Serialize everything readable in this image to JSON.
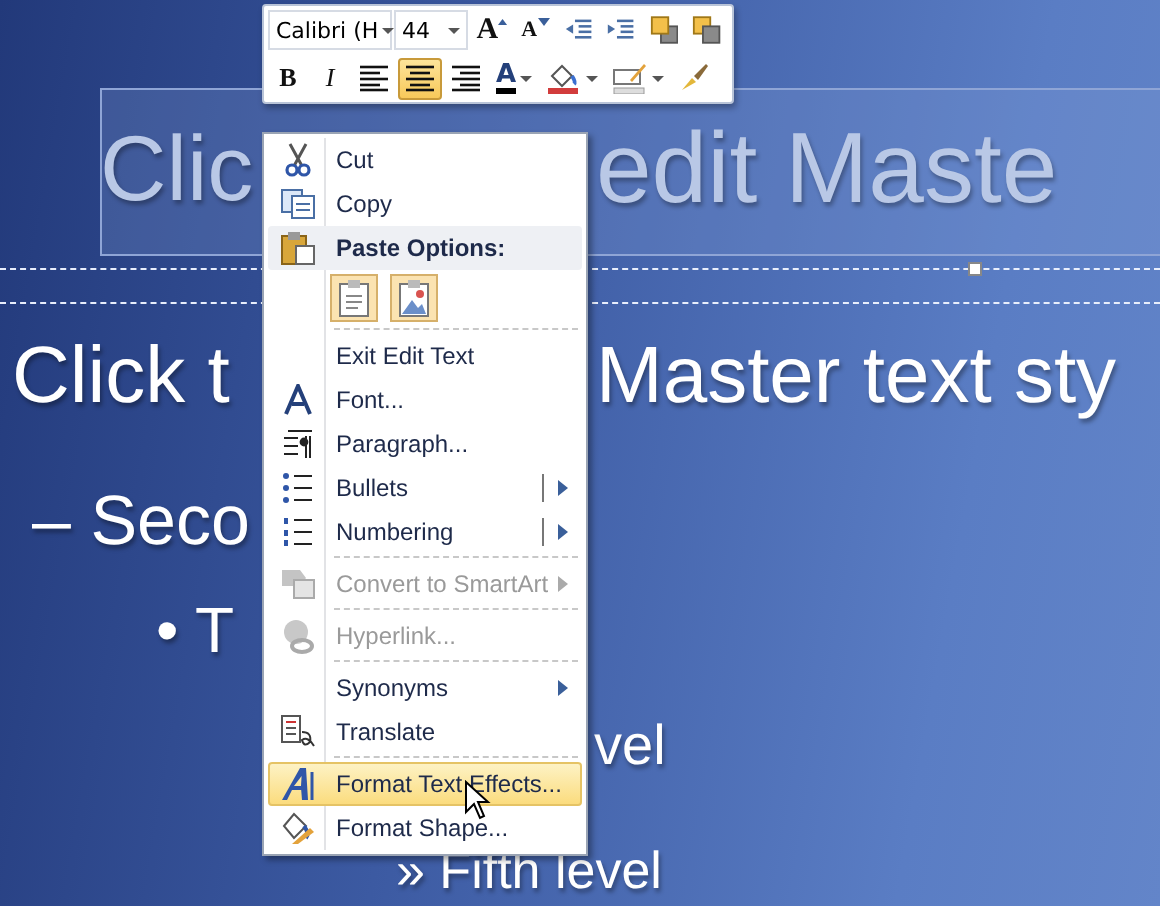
{
  "slide": {
    "title_parts": [
      "Clic",
      "edit Maste"
    ],
    "body_parts": [
      {
        "kind": "level1",
        "text": "Click t"
      },
      {
        "kind": "level1-right",
        "text": "Master text sty"
      },
      {
        "kind": "level2",
        "text": "– Seco"
      },
      {
        "kind": "level3",
        "text": "• T"
      },
      {
        "kind": "level4-right",
        "text": "vel"
      },
      {
        "kind": "level5",
        "text": "» Fifth level"
      }
    ]
  },
  "mini_toolbar": {
    "font": "Calibri (H",
    "size": "44",
    "row1": [
      {
        "kind": "grow-font",
        "label": "A"
      },
      {
        "kind": "shrink-font",
        "label": "A"
      },
      {
        "kind": "decrease-indent"
      },
      {
        "kind": "increase-indent"
      },
      {
        "kind": "bring-forward"
      },
      {
        "kind": "send-backward"
      }
    ],
    "row2": [
      {
        "kind": "bold",
        "label": "B",
        "selected": false
      },
      {
        "kind": "italic",
        "label": "I",
        "selected": false
      },
      {
        "kind": "align-left",
        "selected": false
      },
      {
        "kind": "align-center",
        "selected": true
      },
      {
        "kind": "align-right",
        "selected": false
      },
      {
        "kind": "font-color",
        "label": "A",
        "dropdown": true
      },
      {
        "kind": "fill",
        "dropdown": true
      },
      {
        "kind": "outline",
        "dropdown": true
      },
      {
        "kind": "painter"
      }
    ]
  },
  "context_menu": {
    "items": [
      {
        "kind": "item",
        "label": "Cut",
        "disabled": false,
        "highlighted": false,
        "submenu": false,
        "split": false
      },
      {
        "kind": "item",
        "label": "Copy",
        "disabled": false,
        "highlighted": false,
        "submenu": false,
        "split": false
      },
      {
        "kind": "header",
        "label": "Paste Options:"
      },
      {
        "kind": "paste"
      },
      {
        "kind": "separator"
      },
      {
        "kind": "item",
        "label": "Exit Edit Text",
        "disabled": false,
        "highlighted": false,
        "submenu": false,
        "split": false
      },
      {
        "kind": "item",
        "label": "Font...",
        "disabled": false,
        "highlighted": false,
        "submenu": false,
        "split": false
      },
      {
        "kind": "item",
        "label": "Paragraph...",
        "disabled": false,
        "highlighted": false,
        "submenu": false,
        "split": false
      },
      {
        "kind": "item",
        "label": "Bullets",
        "disabled": false,
        "highlighted": false,
        "submenu": true,
        "split": true
      },
      {
        "kind": "item",
        "label": "Numbering",
        "disabled": false,
        "highlighted": false,
        "submenu": true,
        "split": true
      },
      {
        "kind": "separator"
      },
      {
        "kind": "item",
        "label": "Convert to SmartArt",
        "disabled": true,
        "highlighted": false,
        "submenu": true,
        "split": false
      },
      {
        "kind": "separator"
      },
      {
        "kind": "item",
        "label": "Hyperlink...",
        "disabled": true,
        "highlighted": false,
        "submenu": false,
        "split": false
      },
      {
        "kind": "separator"
      },
      {
        "kind": "item",
        "label": "Synonyms",
        "disabled": false,
        "highlighted": false,
        "submenu": true,
        "split": false
      },
      {
        "kind": "item",
        "label": "Translate",
        "disabled": false,
        "highlighted": false,
        "submenu": false,
        "split": false
      },
      {
        "kind": "separator"
      },
      {
        "kind": "item",
        "label": "Format Text Effects...",
        "disabled": false,
        "highlighted": true,
        "submenu": false,
        "split": false
      },
      {
        "kind": "item",
        "label": "Format Shape...",
        "disabled": false,
        "highlighted": false,
        "submenu": false,
        "split": false
      }
    ]
  }
}
